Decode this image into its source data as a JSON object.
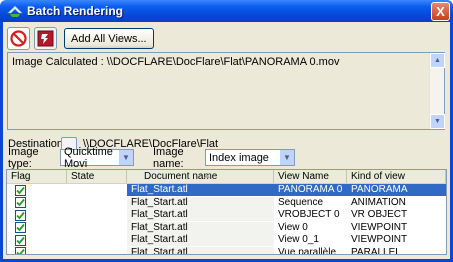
{
  "window": {
    "title": "Batch Rendering",
    "close_label": "X"
  },
  "toolbar": {
    "add_views_label": "Add All Views..."
  },
  "log": {
    "text": "Image Calculated : \\\\DOCFLARE\\DocFlare\\Flat\\PANORAMA 0.mov"
  },
  "destination": {
    "label": "Destination",
    "browse_label": "...",
    "path": "\\\\DOCFLARE\\DocFlare\\Flat"
  },
  "image_type": {
    "label": "Image type:",
    "value": "Quicktime Movi"
  },
  "image_name": {
    "label": "Image name:",
    "value": "Index image"
  },
  "grid": {
    "columns": [
      "Flag",
      "State",
      "Document name",
      "View Name",
      "Kind of view"
    ],
    "rows": [
      {
        "checked": true,
        "state": "",
        "document": "Flat_Start.atl",
        "view": "PANORAMA 0",
        "kind": "PANORAMA"
      },
      {
        "checked": true,
        "state": "",
        "document": "Flat_Start.atl",
        "view": "Sequence",
        "kind": "ANIMATION"
      },
      {
        "checked": true,
        "state": "",
        "document": "Flat_Start.atl",
        "view": "VROBJECT 0",
        "kind": "VR OBJECT"
      },
      {
        "checked": true,
        "state": "",
        "document": "Flat_Start.atl",
        "view": "View 0",
        "kind": "VIEWPOINT"
      },
      {
        "checked": true,
        "state": "",
        "document": "Flat_Start.atl",
        "view": "View 0_1",
        "kind": "VIEWPOINT"
      },
      {
        "checked": true,
        "state": "",
        "document": "Flat_Start.atl",
        "view": "Vue parallèle",
        "kind": "PARALLEL"
      }
    ]
  },
  "colors": {
    "title_bar": "#0a5df0",
    "selection": "#316ac5",
    "window_bg": "#ece9d8"
  }
}
